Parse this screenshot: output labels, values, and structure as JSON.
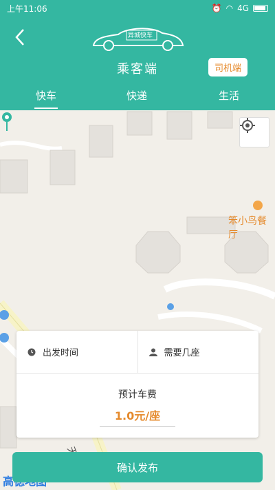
{
  "status_bar": {
    "time": "上午11:06",
    "network": "4G"
  },
  "header": {
    "logo_text": "异城快车",
    "title": "乘客端",
    "driver_button": "司机端",
    "tabs": [
      {
        "label": "快车",
        "active": true
      },
      {
        "label": "快递",
        "active": false
      },
      {
        "label": "生活",
        "active": false
      }
    ]
  },
  "map": {
    "poi_label": "笨小鸟餐厅",
    "provider": "高德地图",
    "road_label": "天"
  },
  "form": {
    "departure_time_label": "出发时间",
    "seats_label": "需要几座",
    "fare_label": "预计车费",
    "fare_value": "1.0元/座",
    "confirm_button": "确认发布"
  },
  "colors": {
    "primary": "#34b7a1",
    "accent": "#e58a2c"
  }
}
